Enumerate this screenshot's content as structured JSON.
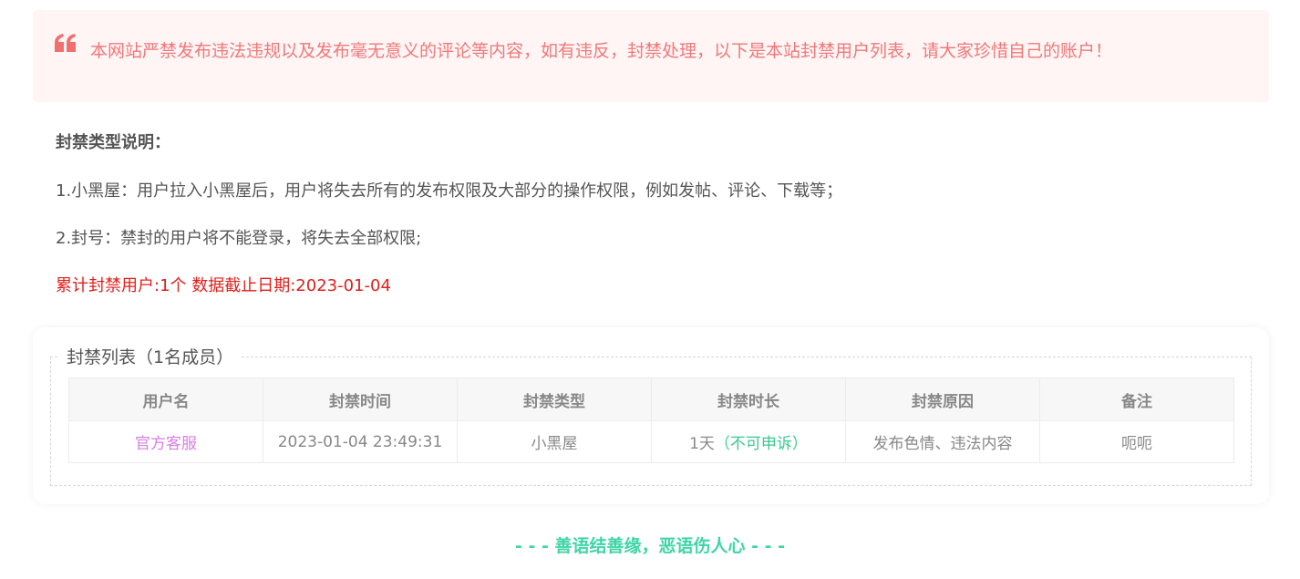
{
  "notice": {
    "icon": "quote-icon",
    "text": "本网站严禁发布违法违规以及发布毫无意义的评论等内容，如有违反，封禁处理，以下是本站封禁用户列表，请大家珍惜自己的账户！",
    "colors": {
      "background": "#fff5f4",
      "text": "#f0787a",
      "icon": "#f07070"
    }
  },
  "intro": {
    "title": "封禁类型说明：",
    "line1": "1.小黑屋：用户拉入小黑屋后，用户将失去所有的发布权限及大部分的操作权限，例如发帖、评论、下载等；",
    "line2": "2.封号：禁封的用户将不能登录，将失去全部权限;",
    "stats": "累计封禁用户:1个 数据截止日期:2023-01-04",
    "stats_color": "#e0201c"
  },
  "list": {
    "legend": "封禁列表（1名成员）",
    "columns": [
      "用户名",
      "封禁时间",
      "封禁类型",
      "封禁时长",
      "封禁原因",
      "备注"
    ],
    "rows": [
      {
        "username": "官方客服",
        "time": "2023-01-04 23:49:31",
        "type": "小黑屋",
        "duration": "1天",
        "appeal": "（不可申诉）",
        "reason": "发布色情、违法内容",
        "remark": "呃呃"
      }
    ],
    "colors": {
      "username": "#d77fe4",
      "appeal": "#3cc98e"
    }
  },
  "footer": {
    "text": "- - - 善语结善缘，恶语伤人心 - - -",
    "color": "#3fd5a5"
  }
}
